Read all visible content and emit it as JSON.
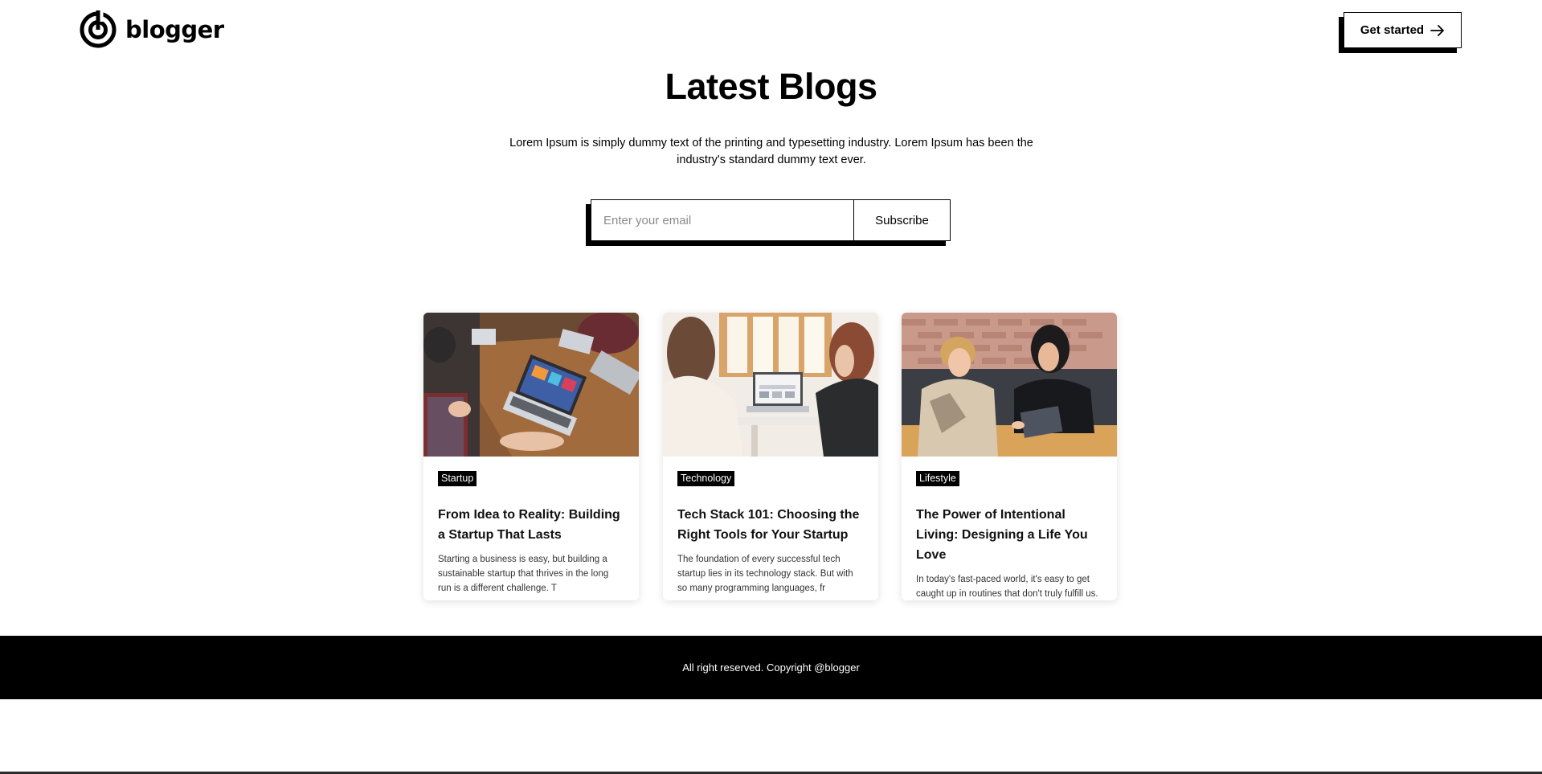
{
  "brand": {
    "name": "blogger",
    "logo_icon": "target-ring-icon"
  },
  "header": {
    "cta_label": "Get started",
    "cta_icon": "arrow-right-icon"
  },
  "hero": {
    "title": "Latest Blogs",
    "description": "Lorem Ipsum is simply dummy text of the printing and typesetting industry. Lorem Ipsum has been the industry's standard dummy text ever."
  },
  "subscribe": {
    "placeholder": "Enter your email",
    "value": "",
    "button_label": "Subscribe"
  },
  "posts": [
    {
      "category": "Startup",
      "title": "From Idea to Reality: Building a Startup That Lasts",
      "excerpt": "Starting a business is easy, but building a sustainable startup that thrives in the long run is a different challenge. T",
      "image": "team-meeting-laptops-photo"
    },
    {
      "category": "Technology",
      "title": "Tech Stack 101: Choosing the Right Tools for Your Startup",
      "excerpt": "The foundation of every successful tech startup lies in its technology stack. But with so many programming languages, fr",
      "image": "women-at-laptop-photo"
    },
    {
      "category": "Lifestyle",
      "title": "The Power of Intentional Living: Designing a Life You Love",
      "excerpt": "In today's fast-paced world, it's easy to get caught up in routines that don't truly fulfill us. But what if you could d",
      "image": "two-women-conversation-photo"
    }
  ],
  "footer": {
    "text": "All right reserved. Copyright @blogger"
  },
  "colors": {
    "primary": "#000000",
    "background": "#ffffff",
    "footer_text": "#ffffff"
  }
}
